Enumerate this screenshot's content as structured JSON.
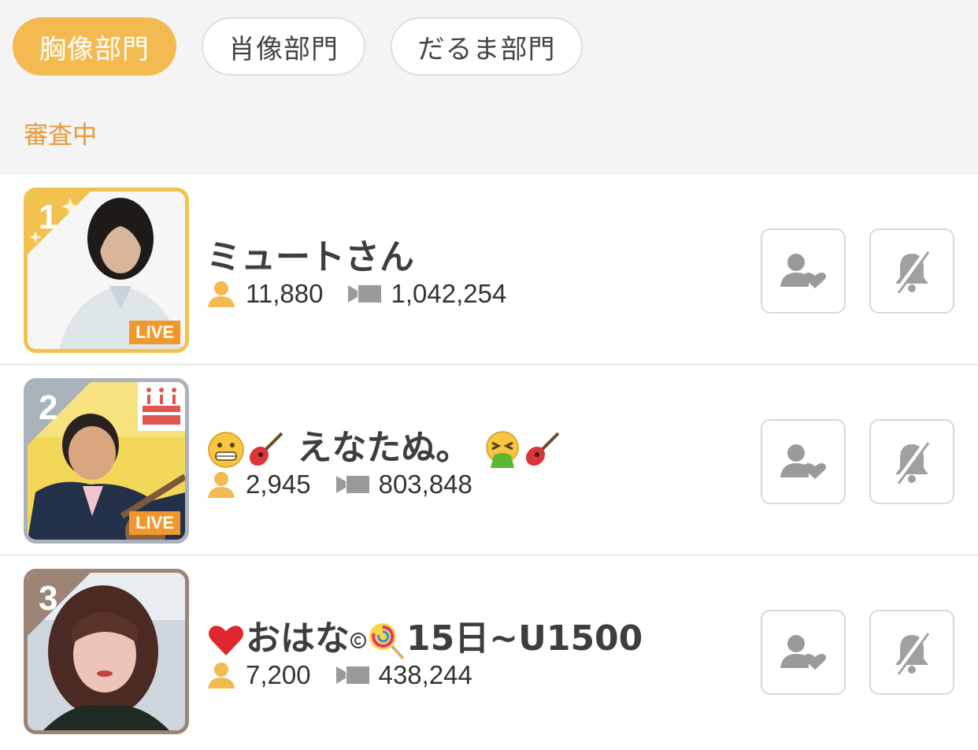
{
  "tabs": [
    {
      "label": "胸像部門",
      "active": true
    },
    {
      "label": "肖像部門",
      "active": false
    },
    {
      "label": "だるま部門",
      "active": false
    }
  ],
  "status": "審査中",
  "rankings": [
    {
      "rank": "1",
      "name": "ミュートさん",
      "followers": "11,880",
      "views": "1,042,254",
      "live": "LIVE",
      "frame_color": "#f1c24e"
    },
    {
      "rank": "2",
      "name": "えなたぬ。",
      "followers": "2,945",
      "views": "803,848",
      "live": "LIVE",
      "frame_color": "#aab2bc"
    },
    {
      "rank": "3",
      "name": "おはな",
      "name_suffix": "15日~U1500",
      "followers": "7,200",
      "views": "438,244",
      "live": null,
      "frame_color": "#9c8477"
    }
  ],
  "icons": {
    "follower": "person-icon",
    "views": "video-camera-icon",
    "follow_button": "person-heart-icon",
    "notify_button": "bell-off-icon"
  },
  "colors": {
    "accent": "#f3ba52",
    "status": "#e69a3a",
    "live_badge": "#f0982e"
  }
}
